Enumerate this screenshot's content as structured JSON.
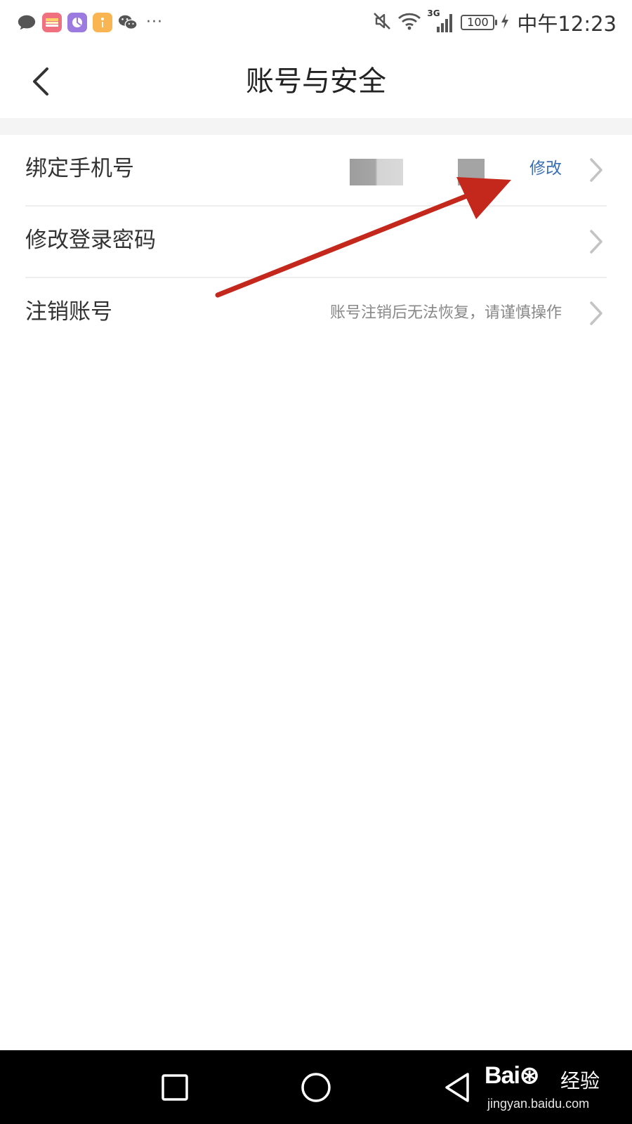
{
  "status_bar": {
    "network": "3G",
    "battery": "100",
    "time": "中午12:23",
    "more": "···",
    "icons": [
      "message-icon",
      "app-icon",
      "gallery-icon",
      "notes-icon",
      "wechat-icon",
      "mute-icon",
      "wifi-icon",
      "signal-icon",
      "charging-icon"
    ]
  },
  "header": {
    "title": "账号与安全",
    "back_icon": "back-chevron-icon"
  },
  "settings": [
    {
      "label": "绑定手机号",
      "action": "修改"
    },
    {
      "label": "修改登录密码"
    },
    {
      "label": "注销账号",
      "hint": "账号注销后无法恢复，请谨慎操作"
    }
  ],
  "colors": {
    "accent": "#3b6fb6",
    "annotation_arrow": "#c4271c"
  },
  "watermark": {
    "logo": "Bai⊛",
    "brand": "经验",
    "url": "jingyan.baidu.com"
  }
}
